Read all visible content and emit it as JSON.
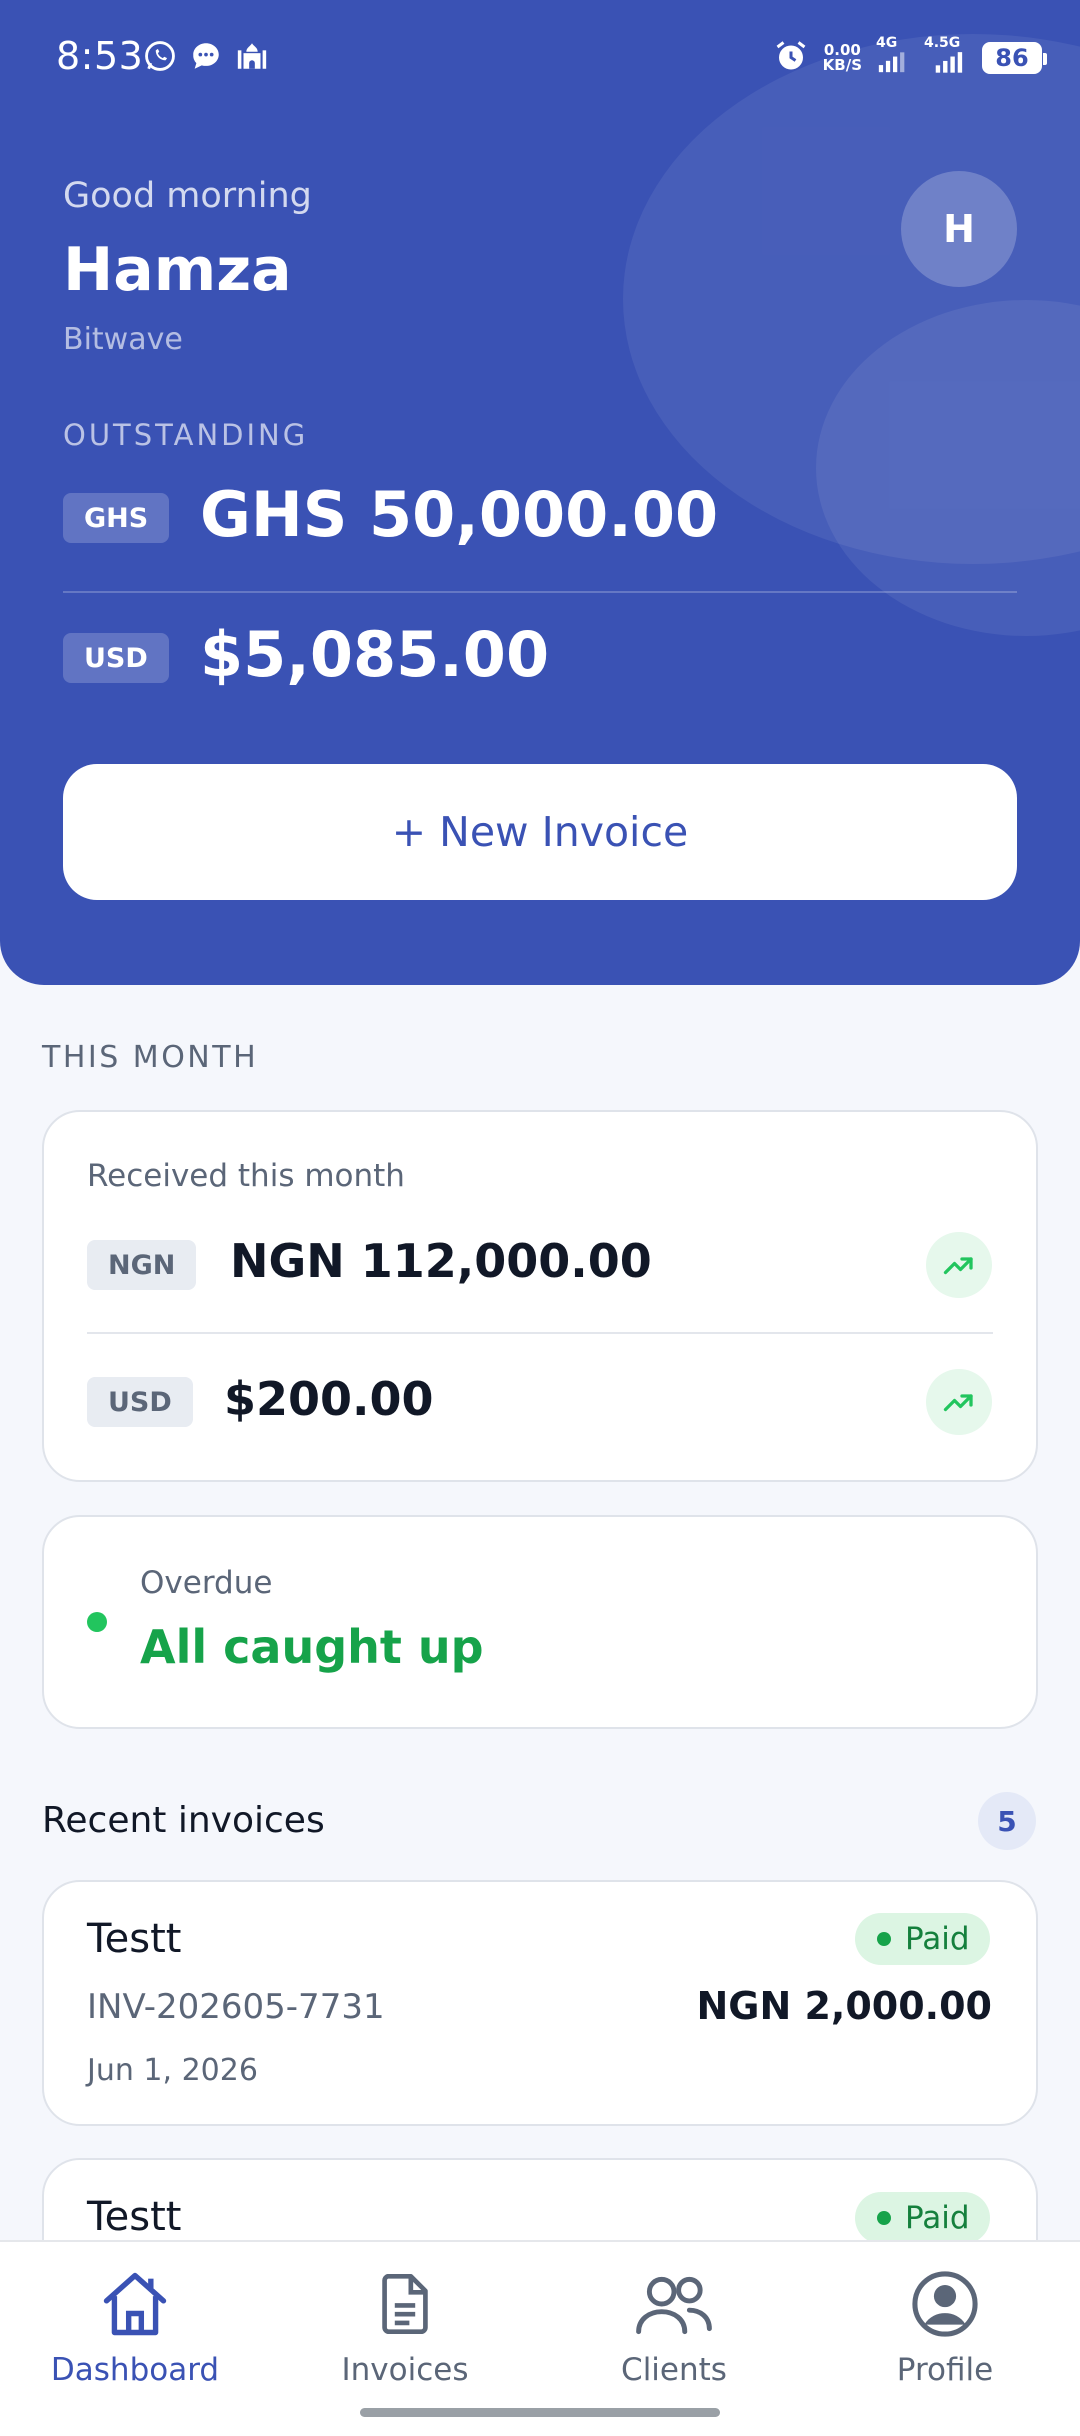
{
  "status_bar": {
    "time": "8:53",
    "left_icons": [
      "whatsapp-icon",
      "message-icon",
      "mosque-icon"
    ],
    "net_speed_value": "0.00",
    "net_speed_unit": "KB/S",
    "sim1_label": "4G",
    "sim2_label": "4.5G",
    "battery": "86"
  },
  "header": {
    "greeting": "Good morning",
    "user_name": "Hamza",
    "company": "Bitwave",
    "avatar_initial": "H"
  },
  "outstanding": {
    "label": "OUTSTANDING",
    "rows": [
      {
        "currency": "GHS",
        "amount": "GHS 50,000.00"
      },
      {
        "currency": "USD",
        "amount": "$5,085.00"
      }
    ]
  },
  "new_invoice_button": "+ New Invoice",
  "this_month": {
    "section_label": "THIS MONTH",
    "received_title": "Received this month",
    "rows": [
      {
        "currency": "NGN",
        "amount": "NGN 112,000.00",
        "trend_icon": "trending-up-icon"
      },
      {
        "currency": "USD",
        "amount": "$200.00",
        "trend_icon": "trending-up-icon"
      }
    ]
  },
  "overdue": {
    "label": "Overdue",
    "value": "All caught up"
  },
  "recent_invoices": {
    "title": "Recent invoices",
    "count": "5",
    "items": [
      {
        "client": "Testt",
        "status": "Paid",
        "number": "INV-202605-7731",
        "amount": "NGN 2,000.00",
        "date": "Jun 1, 2026"
      },
      {
        "client": "Testt",
        "status": "Paid"
      }
    ]
  },
  "bottom_nav": {
    "items": [
      {
        "label": "Dashboard",
        "icon": "home-icon",
        "active": true
      },
      {
        "label": "Invoices",
        "icon": "document-icon",
        "active": false
      },
      {
        "label": "Clients",
        "icon": "users-icon",
        "active": false
      },
      {
        "label": "Profile",
        "icon": "user-circle-icon",
        "active": false
      }
    ]
  },
  "colors": {
    "primary": "#3a52b4",
    "success": "#16a34a",
    "background": "#f5f7fc"
  }
}
